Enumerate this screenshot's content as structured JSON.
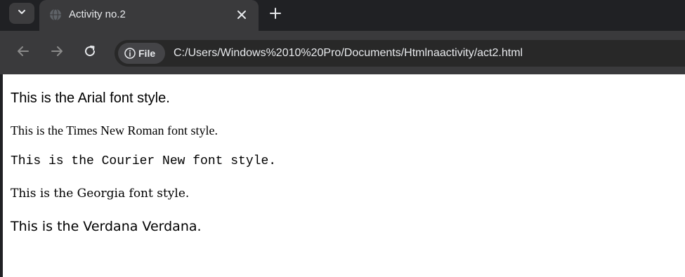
{
  "browser": {
    "tab": {
      "title": "Activity no.2",
      "favicon": "globe-icon"
    },
    "toolbar": {
      "site_chip_label": "File",
      "url": "C:/Users/Windows%2010%20Pro/Documents/Htmlnaactivity/act2.html"
    },
    "colors": {
      "tabstrip_bg": "#202124",
      "toolbar_bg": "#3a3a3c",
      "omnibox_bg": "#282828",
      "text_light": "#e8eaed",
      "icon_muted": "#8a8a8a"
    }
  },
  "page": {
    "lines": [
      "This is the Arial font style.",
      "This is the Times New Roman font style.",
      "This is the Courier New font style.",
      "This is the Georgia font style.",
      "This is the Verdana Verdana."
    ]
  }
}
